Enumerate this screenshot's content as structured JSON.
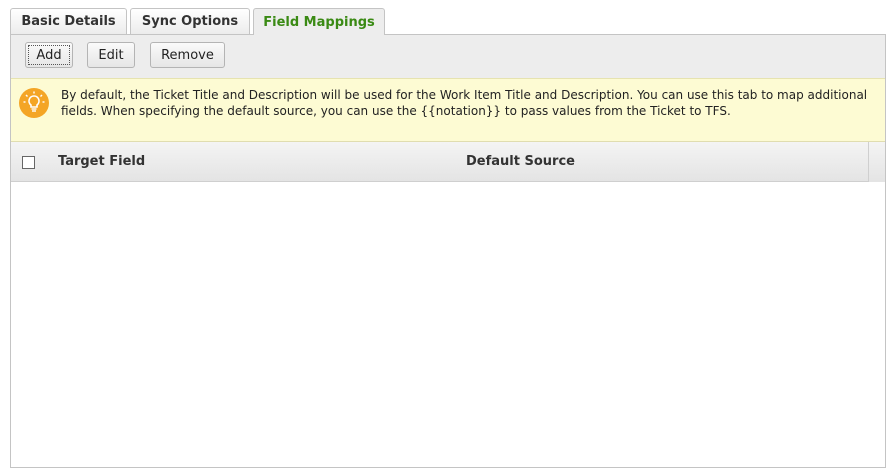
{
  "tabs": [
    {
      "label": "Basic Details"
    },
    {
      "label": "Sync Options"
    },
    {
      "label": "Field Mappings",
      "active": true
    }
  ],
  "toolbar": {
    "add_label": "Add",
    "edit_label": "Edit",
    "remove_label": "Remove"
  },
  "info": {
    "icon": "lightbulb-icon",
    "text": "By default, the Ticket Title and Description will be used for the Work Item Title and Description. You can use this tab to map additional fields. When specifying the default source, you can use the {{notation}} to pass values from the Ticket to TFS."
  },
  "grid": {
    "columns": [
      "Target Field",
      "Default Source"
    ],
    "rows": []
  },
  "colors": {
    "active_tab_text": "#3a8a14",
    "info_background": "#fdfbd3",
    "info_icon": "#f4a525"
  }
}
